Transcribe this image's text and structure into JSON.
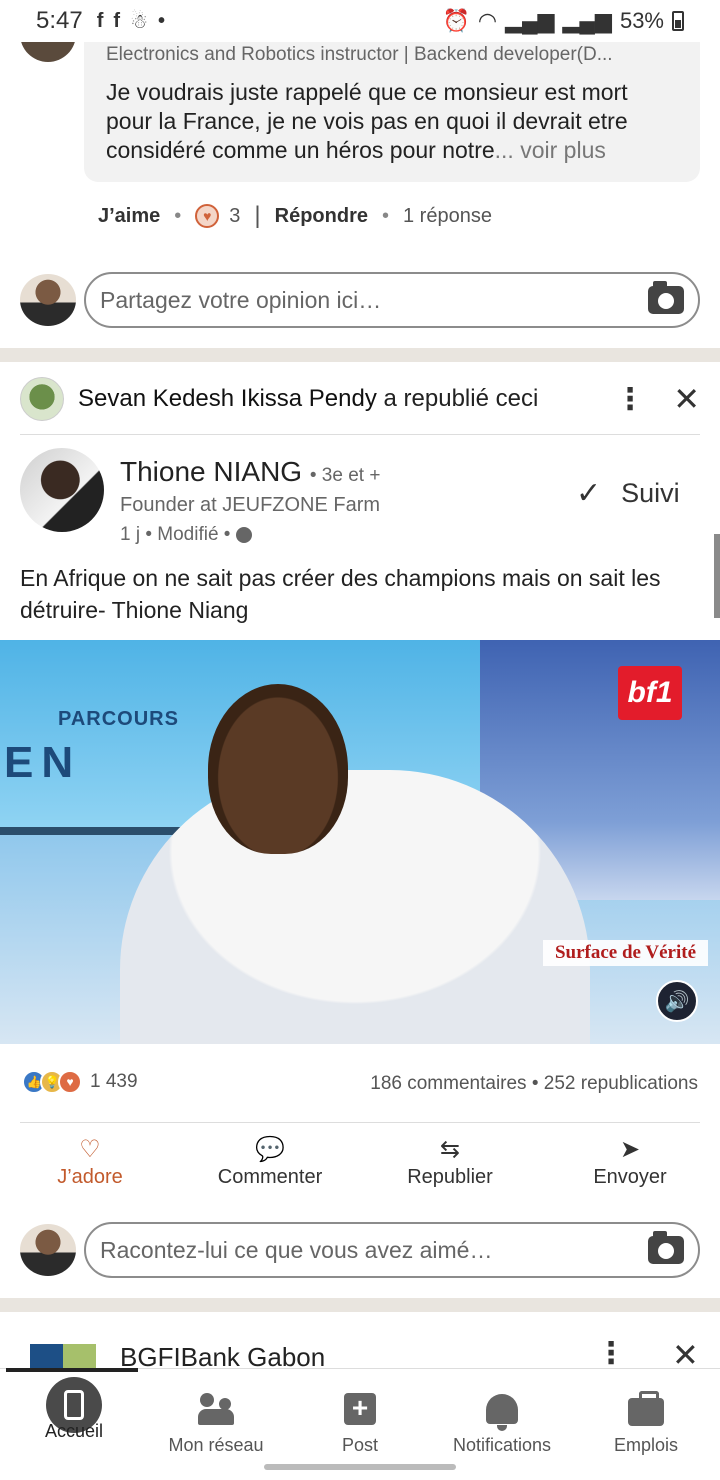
{
  "status_bar": {
    "time": "5:47",
    "battery": "53%",
    "left_icons": [
      "facebook-icon",
      "facebook-icon",
      "android-icon",
      "dot-icon"
    ],
    "right_icons": [
      "alarm-icon",
      "wifi-icon",
      "signal-icon",
      "signal-icon",
      "battery-icon"
    ]
  },
  "comment": {
    "headline": "Electronics and Robotics instructor | Backend developer(D...",
    "text": "Je voudrais juste rappelé que ce monsieur est mort pour la France, je ne vois pas en quoi il devrait etre considéré comme un héros pour notre",
    "ellipsis": "...",
    "more": "voir plus",
    "like_label": "J’aime",
    "reaction_count": "3",
    "reply_label": "Répondre",
    "replies": "1 réponse"
  },
  "comment_input": {
    "placeholder": "Partagez votre opinion ici…"
  },
  "repost": {
    "reposter": "Sevan Kedesh Ikissa Pendy",
    "action": "a republié ceci"
  },
  "post": {
    "author_name": "Thione NIANG",
    "author_degree": "• 3e et +",
    "author_title": "Founder at JEUFZONE Farm",
    "time": "1 j • Modifié •",
    "follow_label": "Suivi",
    "text": "En Afrique on ne sait pas créer des champions mais on sait les détruire- Thione Niang",
    "video": {
      "overlay_parcours": "PARCOURS",
      "overlay_en": "EN",
      "channel_logo": "bf1",
      "caption": "Surface de Vérité"
    },
    "reaction_total": "1 439",
    "stats": "186 commentaires • 252 republications",
    "actions": [
      {
        "label": "J’adore",
        "icon": "heart-icon"
      },
      {
        "label": "Commenter",
        "icon": "comment-icon"
      },
      {
        "label": "Republier",
        "icon": "repost-icon"
      },
      {
        "label": "Envoyer",
        "icon": "send-icon"
      }
    ]
  },
  "post_input": {
    "placeholder": "Racontez-lui ce que vous avez aimé…"
  },
  "next_post": {
    "name": "BGFIBank Gabon"
  },
  "bottom_nav": [
    {
      "label": "Accueil",
      "icon": "home-icon"
    },
    {
      "label": "Mon réseau",
      "icon": "network-icon"
    },
    {
      "label": "Post",
      "icon": "post-icon"
    },
    {
      "label": "Notifications",
      "icon": "bell-icon"
    },
    {
      "label": "Emplois",
      "icon": "briefcase-icon"
    }
  ],
  "colors": {
    "accent": "#c25a2c",
    "separator": "#e9e5df"
  }
}
